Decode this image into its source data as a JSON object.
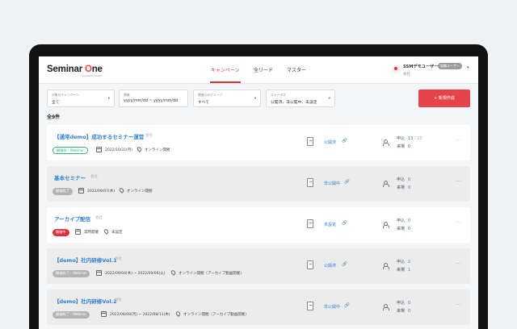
{
  "app": {
    "logo_main": "Seminar ",
    "logo_accent": "O",
    "logo_end": "ne",
    "logo_sub": "powered by sansan"
  },
  "nav": {
    "items": [
      "キャンペーン",
      "全リード",
      "マスター"
    ]
  },
  "user": {
    "name": "SSMデモユーザー",
    "role": "組織ユーザー",
    "org": "会社",
    "caret": "▾"
  },
  "filters": [
    {
      "label": "対象のキャンペーン",
      "value": "全て",
      "caret": "▾"
    },
    {
      "label": "開催",
      "value": "yyyy/mm/dd ~ yyyy/mm/dd",
      "caret": ""
    },
    {
      "label": "開催元のグループ",
      "value": "すべて",
      "caret": "▾"
    },
    {
      "label": "ステータス",
      "value": "公開済、非公開中、未設定",
      "caret": "▾"
    }
  ],
  "new_button": "+ 新規作成",
  "total": "全9件",
  "campaigns": [
    {
      "title": "【通常demo】成功するセミナー運営",
      "org": "会社",
      "badge": "開催前・Webinar",
      "badge_style": "outline-green",
      "date": "2022/10/31(月)",
      "place": "オンライン開催",
      "status": "公開済",
      "link_muted": false,
      "apply": "申込",
      "apply_num": "13",
      "apply_cap": "/ 20",
      "attend": "来場",
      "attend_num": "0",
      "more": "···"
    },
    {
      "title": "基本セミナー",
      "org": "会社",
      "badge": "開催終了",
      "badge_style": "gray-fill",
      "date": "2022/09/07(木)",
      "place": "オンライン開催",
      "status": "非公開中",
      "link_muted": false,
      "apply": "申込",
      "apply_num": "0",
      "apply_cap": "",
      "attend": "来場",
      "attend_num": "0",
      "more": "···"
    },
    {
      "title": "アーカイブ配信",
      "org": "会社",
      "badge": "開催中",
      "badge_style": "red-fill",
      "date": "常時開催",
      "place": "未設定",
      "status": "未設定",
      "link_muted": true,
      "apply": "申込",
      "apply_num": "0",
      "apply_cap": "",
      "attend": "来場",
      "attend_num": "0",
      "more": "···"
    },
    {
      "title": "【demo】社内研修Vol.1",
      "org": "会社",
      "badge": "開催終了・Webinar",
      "badge_style": "gray-fill",
      "date": "2022/09/04(木) ~ 2022/09/06(火)",
      "place": "オンライン開催（アーカイブ動画開催）",
      "status": "公開済",
      "link_muted": false,
      "apply": "申込",
      "apply_num": "2",
      "apply_cap": "",
      "attend": "来場",
      "attend_num": "1",
      "more": "···"
    },
    {
      "title": "【demo】社内研修Vol.2",
      "org": "会社",
      "badge": "開催終了・Webinar",
      "badge_style": "gray-fill",
      "date": "2022/08/08(月) ~ 2022/08/11(木)",
      "place": "オンライン開催（アーカイブ動画開催）",
      "status": "非公開中",
      "link_muted": false,
      "apply": "申込",
      "apply_num": "0",
      "apply_cap": "",
      "attend": "来場",
      "attend_num": "0",
      "more": "···"
    }
  ],
  "colors": {
    "accent": "#e0303a",
    "link": "#2f7fd4",
    "success": "#36b37e"
  }
}
